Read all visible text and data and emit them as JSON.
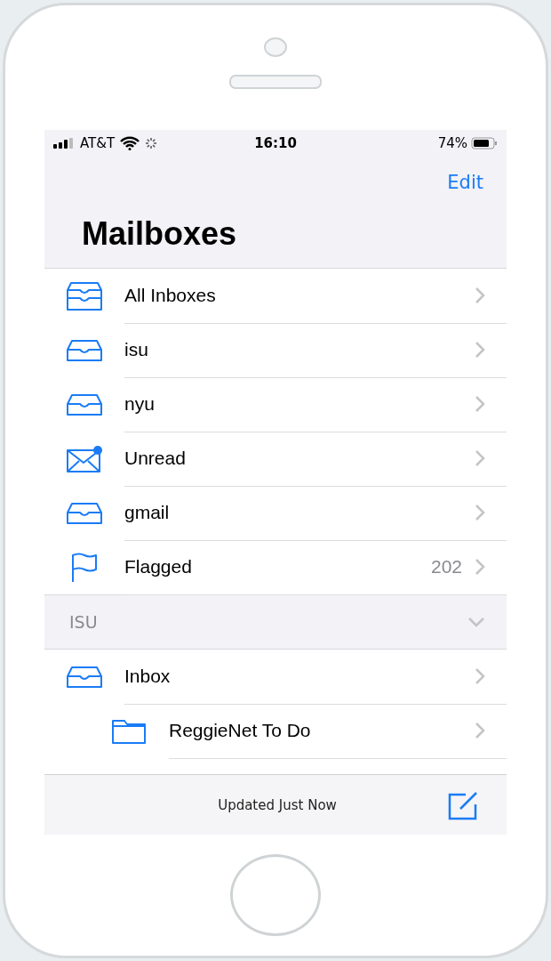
{
  "status_bar": {
    "carrier": "AT&T",
    "time": "16:10",
    "battery": "74%"
  },
  "nav": {
    "edit": "Edit",
    "title": "Mailboxes"
  },
  "mailboxes": [
    {
      "kind": "all-inboxes",
      "label": "All Inboxes"
    },
    {
      "kind": "inbox",
      "label": "isu"
    },
    {
      "kind": "inbox",
      "label": "nyu"
    },
    {
      "kind": "unread",
      "label": "Unread"
    },
    {
      "kind": "inbox",
      "label": "gmail"
    },
    {
      "kind": "flagged",
      "label": "Flagged",
      "count": "202"
    }
  ],
  "sections": [
    {
      "title": "ISU",
      "expanded": true,
      "items": [
        {
          "kind": "inbox",
          "label": "Inbox",
          "children": [
            {
              "kind": "folder",
              "label": "ReggieNet To Do"
            }
          ]
        }
      ]
    }
  ],
  "toolbar": {
    "status": "Updated Just Now"
  }
}
